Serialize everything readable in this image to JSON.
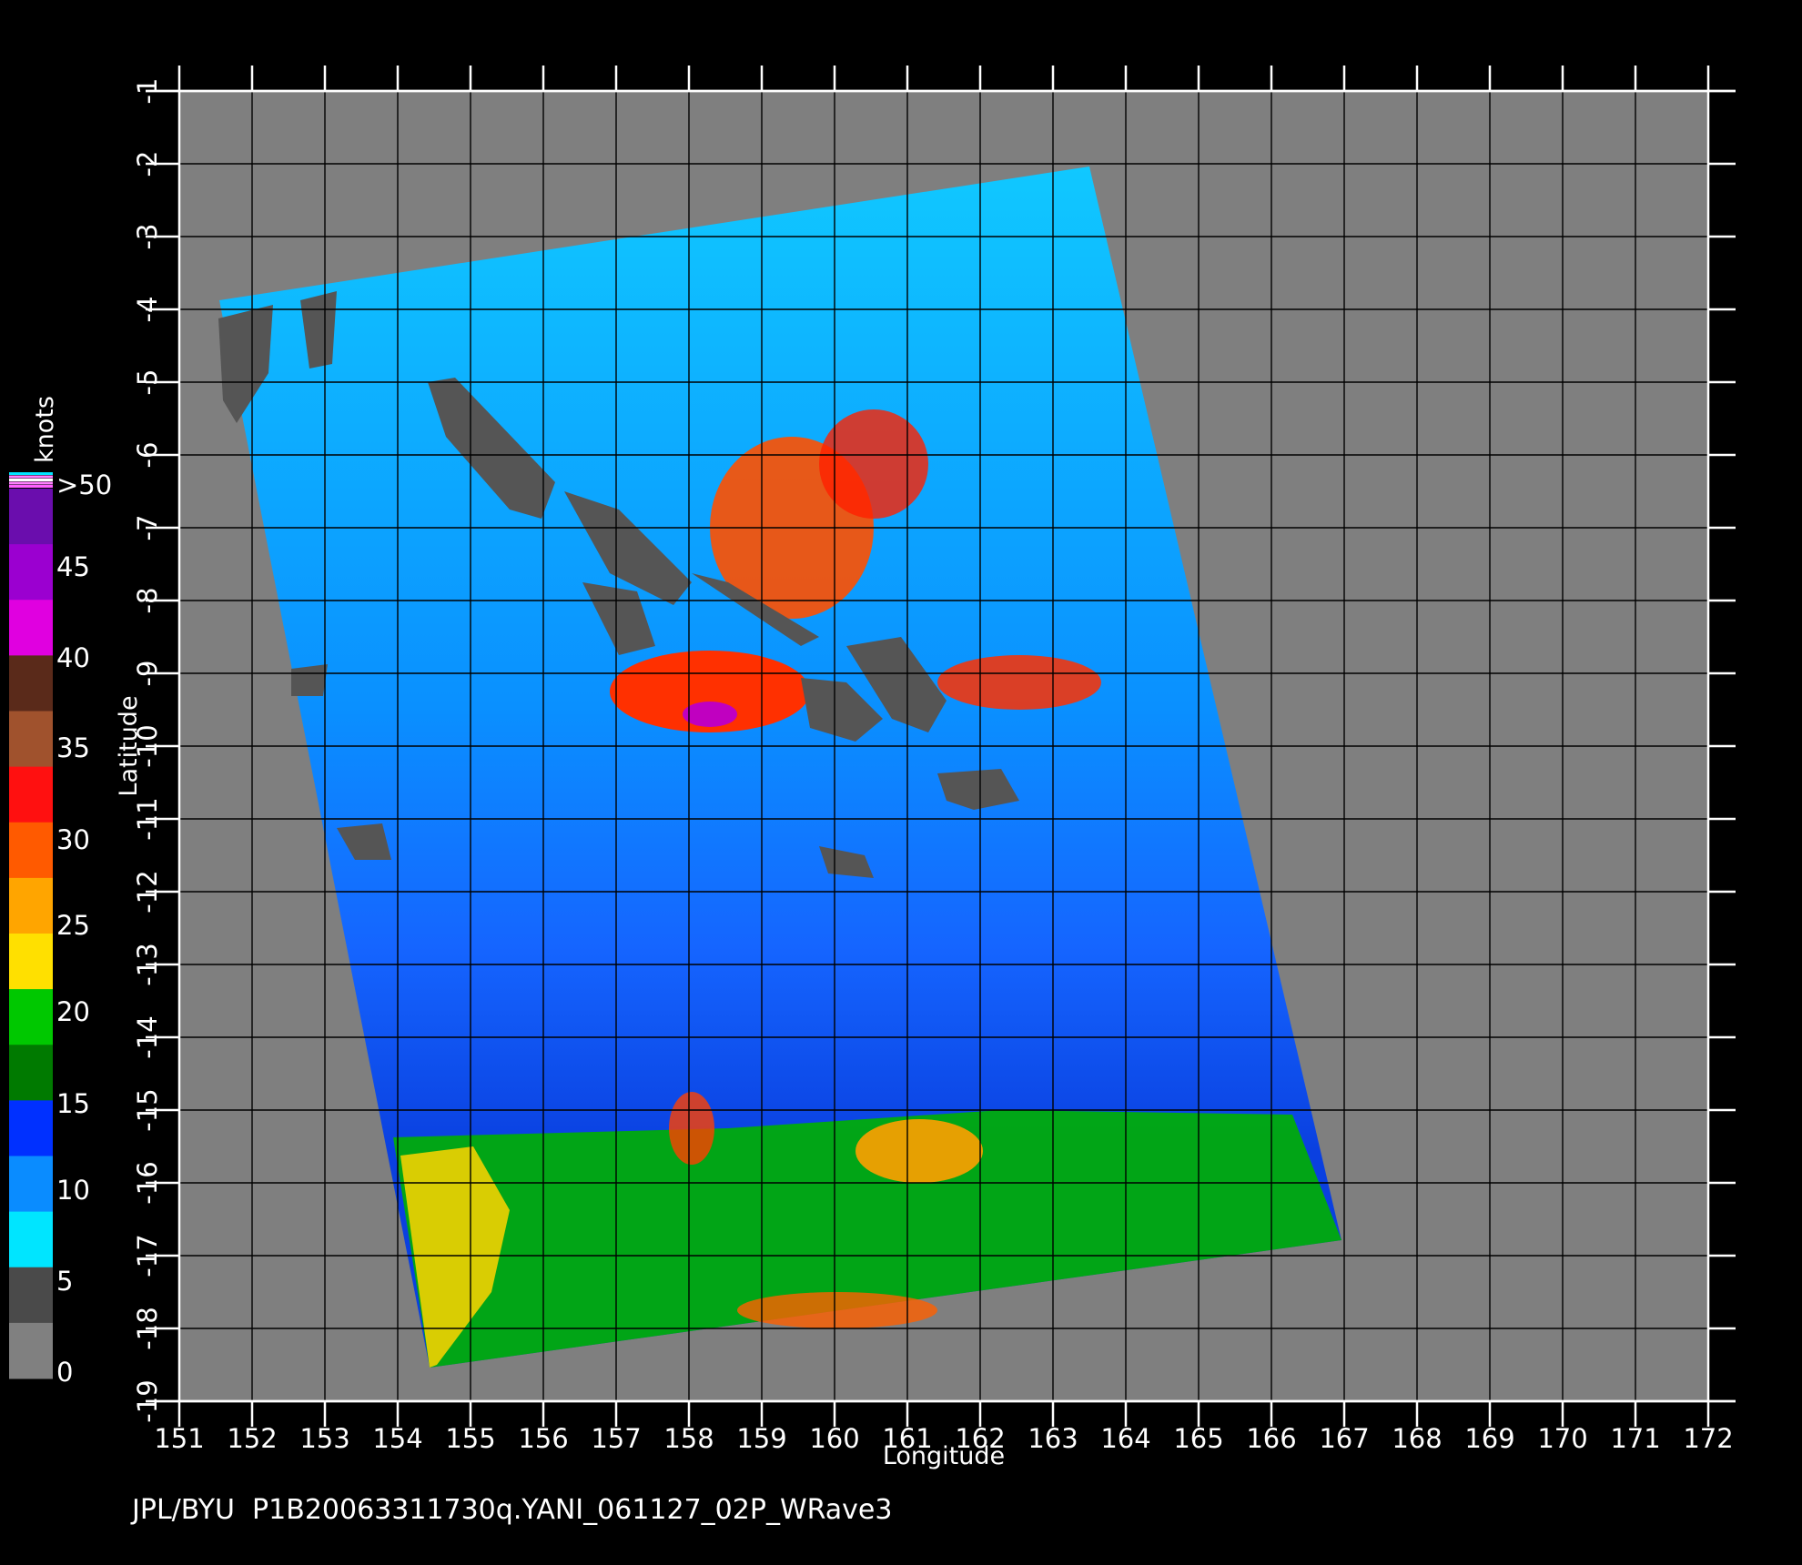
{
  "map": {
    "caption": "JPL/BYU  P1B20063311730q.YANI_061127_02P_WRave3",
    "xlabel": "Longitude",
    "ylabel": "Latitude",
    "lon_ticks": [
      "151",
      "152",
      "153",
      "154",
      "155",
      "156",
      "157",
      "158",
      "159",
      "160",
      "161",
      "162",
      "163",
      "164",
      "165",
      "166",
      "167",
      "168",
      "169",
      "170",
      "171",
      "172"
    ],
    "lat_ticks": [
      "-1",
      "-2",
      "-3",
      "-4",
      "-5",
      "-6",
      "-7",
      "-8",
      "-9",
      "-10",
      "-11",
      "-12",
      "-13",
      "-14",
      "-15",
      "-16",
      "-17",
      "-18",
      "-19"
    ],
    "colorbar": {
      "unit": "knots",
      "labels": [
        ">50",
        "45",
        "40",
        "35",
        "30",
        "25",
        "20",
        "15",
        "10",
        "5",
        "0"
      ],
      "colors": [
        "#6a0dad",
        "#9b00d0",
        "#e000e0",
        "#5a2a1a",
        "#a0522d",
        "#ff1010",
        "#ff5a00",
        "#ffa500",
        "#ffe000",
        "#00c800",
        "#007a00",
        "#0030ff",
        "#0a8cff",
        "#00e5ff",
        "#4a4a4a",
        "#808080"
      ]
    },
    "background_color": "#7f7f7f",
    "swath_colors": {
      "calm": "#00d8ff",
      "light": "#0060ff",
      "moderate": "#00b000",
      "strong": "#ffe600",
      "gale": "#ff3300",
      "land": "#555555"
    }
  }
}
